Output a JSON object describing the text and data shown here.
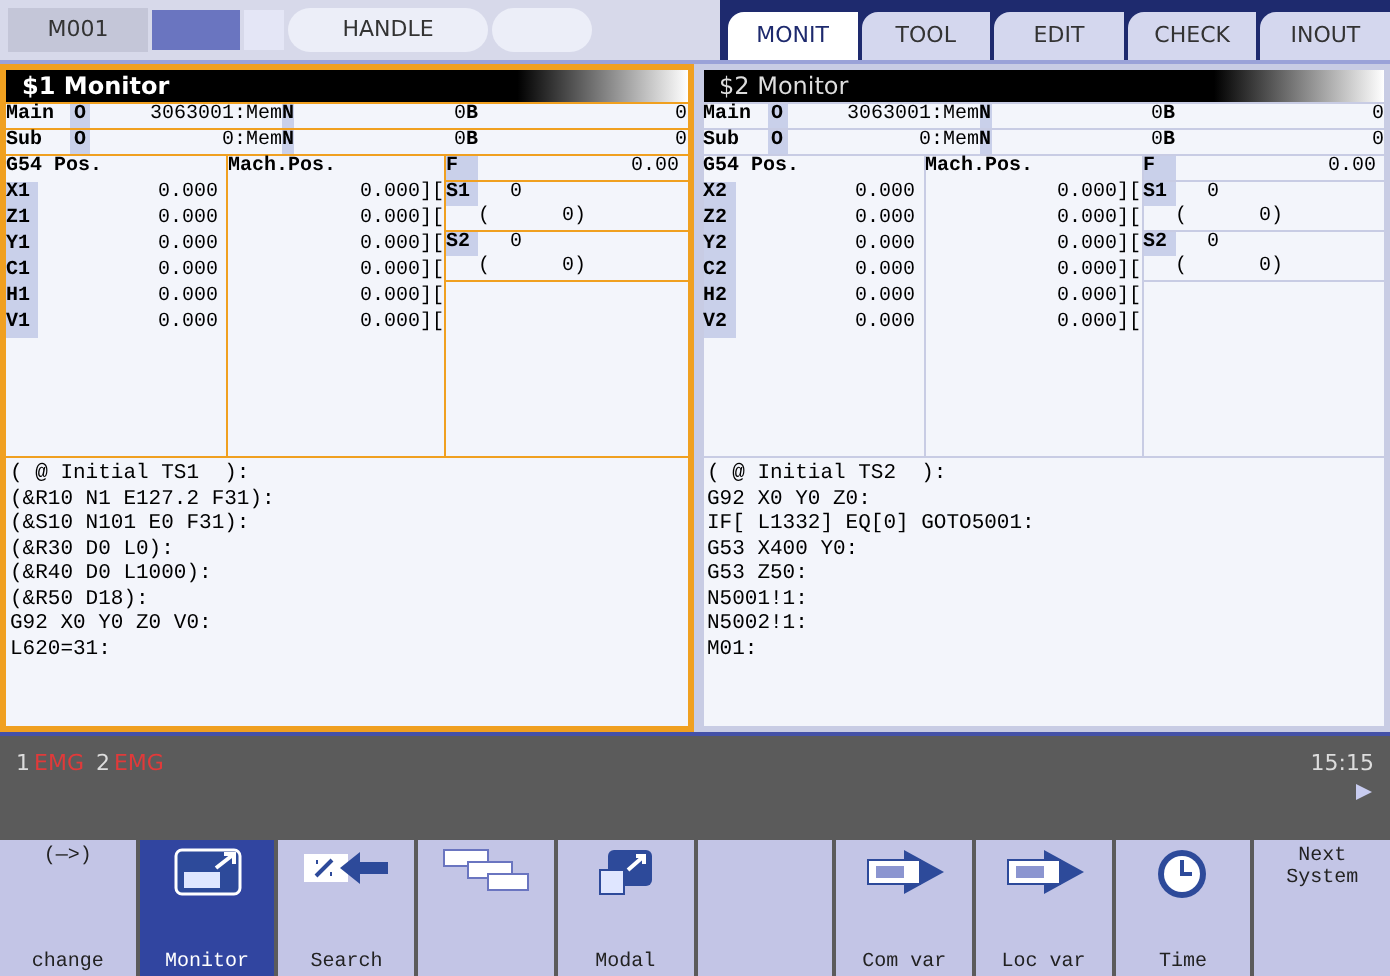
{
  "mode_bar": {
    "machine": "M001",
    "indicators": [
      {
        "color": "#6a75c0"
      },
      {
        "color": "#e4e6f6"
      }
    ],
    "mode": "HANDLE"
  },
  "tabs": [
    {
      "label": "MONIT",
      "selected": true
    },
    {
      "label": "TOOL",
      "selected": false
    },
    {
      "label": "EDIT",
      "selected": false
    },
    {
      "label": "CHECK",
      "selected": false
    },
    {
      "label": "INOUT",
      "selected": false
    }
  ],
  "panels": [
    {
      "title": "$1 Monitor",
      "selected": true,
      "program_rows": [
        {
          "label": "Main",
          "o_label": "O",
          "program": "3063001:Mem",
          "n_label": "N",
          "n_value": "0",
          "b_label": "B",
          "b_value": "0"
        },
        {
          "label": "Sub",
          "o_label": "O",
          "program": "0:Mem",
          "n_label": "N",
          "n_value": "0",
          "b_label": "B",
          "b_value": "0"
        }
      ],
      "position_headers": [
        "G54 Pos.",
        "Mach.Pos."
      ],
      "axes": [
        {
          "name": "X1",
          "work": "0.000",
          "machine": "0.000]["
        },
        {
          "name": "Z1",
          "work": "0.000",
          "machine": "0.000]["
        },
        {
          "name": "Y1",
          "work": "0.000",
          "machine": "0.000]["
        },
        {
          "name": "C1",
          "work": "0.000",
          "machine": "0.000]["
        },
        {
          "name": "H1",
          "work": "0.000",
          "machine": "0.000]["
        },
        {
          "name": "V1",
          "work": "0.000",
          "machine": "0.000]["
        }
      ],
      "feed": {
        "label": "F",
        "value": "0.00"
      },
      "spindles": [
        {
          "label": "S1",
          "value": "0",
          "sub": "(      0)"
        },
        {
          "label": "S2",
          "value": "0",
          "sub": "(      0)"
        }
      ],
      "program_lines": [
        "( @ Initial TS1  ):",
        "(&R10 N1 E127.2 F31):",
        "(&S10 N101 E0 F31):",
        "(&R30 D0 L0):",
        "(&R40 D0 L1000):",
        "(&R50 D18):",
        "G92 X0 Y0 Z0 V0:",
        "L620=31:"
      ]
    },
    {
      "title": "$2 Monitor",
      "selected": false,
      "program_rows": [
        {
          "label": "Main",
          "o_label": "O",
          "program": "3063001:Mem",
          "n_label": "N",
          "n_value": "0",
          "b_label": "B",
          "b_value": "0"
        },
        {
          "label": "Sub",
          "o_label": "O",
          "program": "0:Mem",
          "n_label": "N",
          "n_value": "0",
          "b_label": "B",
          "b_value": "0"
        }
      ],
      "position_headers": [
        "G54 Pos.",
        "Mach.Pos."
      ],
      "axes": [
        {
          "name": "X2",
          "work": "0.000",
          "machine": "0.000]["
        },
        {
          "name": "Z2",
          "work": "0.000",
          "machine": "0.000]["
        },
        {
          "name": "Y2",
          "work": "0.000",
          "machine": "0.000]["
        },
        {
          "name": "C2",
          "work": "0.000",
          "machine": "0.000]["
        },
        {
          "name": "H2",
          "work": "0.000",
          "machine": "0.000]["
        },
        {
          "name": "V2",
          "work": "0.000",
          "machine": "0.000]["
        }
      ],
      "feed": {
        "label": "F",
        "value": "0.00"
      },
      "spindles": [
        {
          "label": "S1",
          "value": "0",
          "sub": "(      0)"
        },
        {
          "label": "S2",
          "value": "0",
          "sub": "(      0)"
        }
      ],
      "program_lines": [
        "( @ Initial TS2  ):",
        "G92 X0 Y0 Z0:",
        "IF[ L1332] EQ[0] GOTO5001:",
        "G53 X400 Y0:",
        "G53 Z50:",
        "N5001!1:",
        "N5002!1:",
        "M01:"
      ]
    }
  ],
  "status_bar": {
    "alarms": [
      {
        "number": "1",
        "text": "EMG"
      },
      {
        "number": "2",
        "text": "EMG"
      }
    ],
    "time": "15:15"
  },
  "softkeys": [
    {
      "kind": "text",
      "top": "(—>)",
      "label": "change",
      "selected": false
    },
    {
      "kind": "monitor",
      "label": "Monitor",
      "selected": true
    },
    {
      "kind": "search",
      "label": "Search",
      "selected": false
    },
    {
      "kind": "windows",
      "selected": false
    },
    {
      "kind": "modal",
      "label": "Modal",
      "selected": false
    },
    {
      "kind": "blank",
      "selected": false
    },
    {
      "kind": "variable",
      "label": "Com var",
      "selected": false
    },
    {
      "kind": "variable",
      "label": "Loc var",
      "selected": false
    },
    {
      "kind": "clock",
      "label": "Time",
      "selected": false
    },
    {
      "kind": "text",
      "label": "Next System",
      "selected": false
    }
  ]
}
